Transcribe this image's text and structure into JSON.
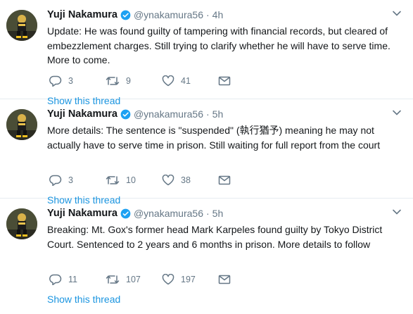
{
  "tweets": [
    {
      "name": "Yuji Nakamura",
      "handle": "@ynakamura56",
      "separator": "·",
      "time": "4h",
      "text": "Update: He was found guilty of tampering with financial records, but cleared of embezzlement charges. Still trying to clarify whether he will have to serve time. More to come.",
      "replies": "3",
      "retweets": "9",
      "likes": "41",
      "thread_link": "Show this thread"
    },
    {
      "name": "Yuji Nakamura",
      "handle": "@ynakamura56",
      "separator": "·",
      "time": "5h",
      "text": "More details: The sentence is \"suspended\" (執行猶予) meaning he may not actually have to serve time in prison. Still waiting for full report from the court",
      "replies": "3",
      "retweets": "10",
      "likes": "38",
      "thread_link": "Show this thread"
    },
    {
      "name": "Yuji Nakamura",
      "handle": "@ynakamura56",
      "separator": "·",
      "time": "5h",
      "text": "Breaking: Mt. Gox's former head Mark Karpeles found guilty by Tokyo District Court. Sentenced to 2 years and 6 months in prison. More details to follow",
      "replies": "11",
      "retweets": "107",
      "likes": "197",
      "thread_link": "Show this thread"
    }
  ],
  "icons": {
    "verified": "verified-badge-icon",
    "caret": "chevron-down-icon",
    "reply": "reply-icon",
    "retweet": "retweet-icon",
    "like": "heart-icon",
    "message": "envelope-icon"
  },
  "colors": {
    "text": "#14171a",
    "secondary": "#657786",
    "link": "#1b95e0",
    "verified": "#1da1f2",
    "divider": "#e6ecf0"
  }
}
